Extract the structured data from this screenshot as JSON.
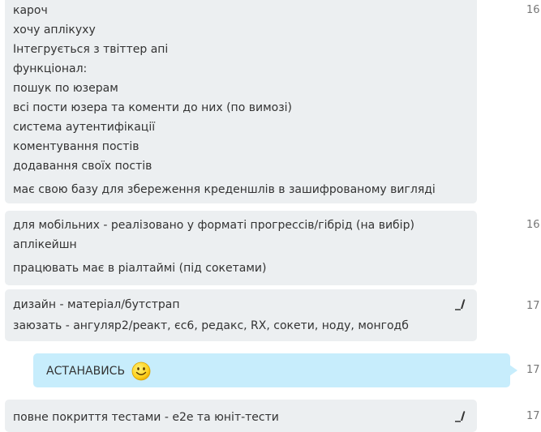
{
  "messages": [
    {
      "time": "16",
      "lines": [
        "кароч",
        "хочу аплікуху",
        "Інтегрується з твіттер апі",
        "функціонал:",
        "пошук по юзерам",
        "всі пости юзера та коменти до них (по вимозі)",
        "система аутентифікації",
        "коментування постів",
        "додавання своїх постів",
        "має свою базу для збереження креденшлів в зашифрованому вигляді"
      ]
    },
    {
      "time": "16",
      "lines": [
        "для мобільних - реалізовано у форматі прогрессів/гібрід (на вибір)",
        "аплікейшн",
        "працювать має в ріалтаймі (під сокетами)"
      ]
    },
    {
      "time": "17",
      "edited": true,
      "lines": [
        "дизайн - матеріал/бутстрап",
        "заюзать - ангуляр2/реакт, єс6, редакс, RX, сокети, ноду, монгодб"
      ]
    },
    {
      "time": "17",
      "outgoing": true,
      "lines": [
        "АСТАНАВИСЬ"
      ],
      "emoji": "smiley-emoji"
    },
    {
      "time": "17",
      "edited": true,
      "lines": [
        "повне покриття тестами - е2е та юніт-тести"
      ]
    }
  ],
  "icons": {
    "edit": "pencil-edit-icon",
    "emoji": "smiley-face-icon"
  },
  "colors": {
    "incoming_bg": "#eceff1",
    "outgoing_bg": "#c7edfc",
    "text": "#333333",
    "time": "#777777"
  }
}
